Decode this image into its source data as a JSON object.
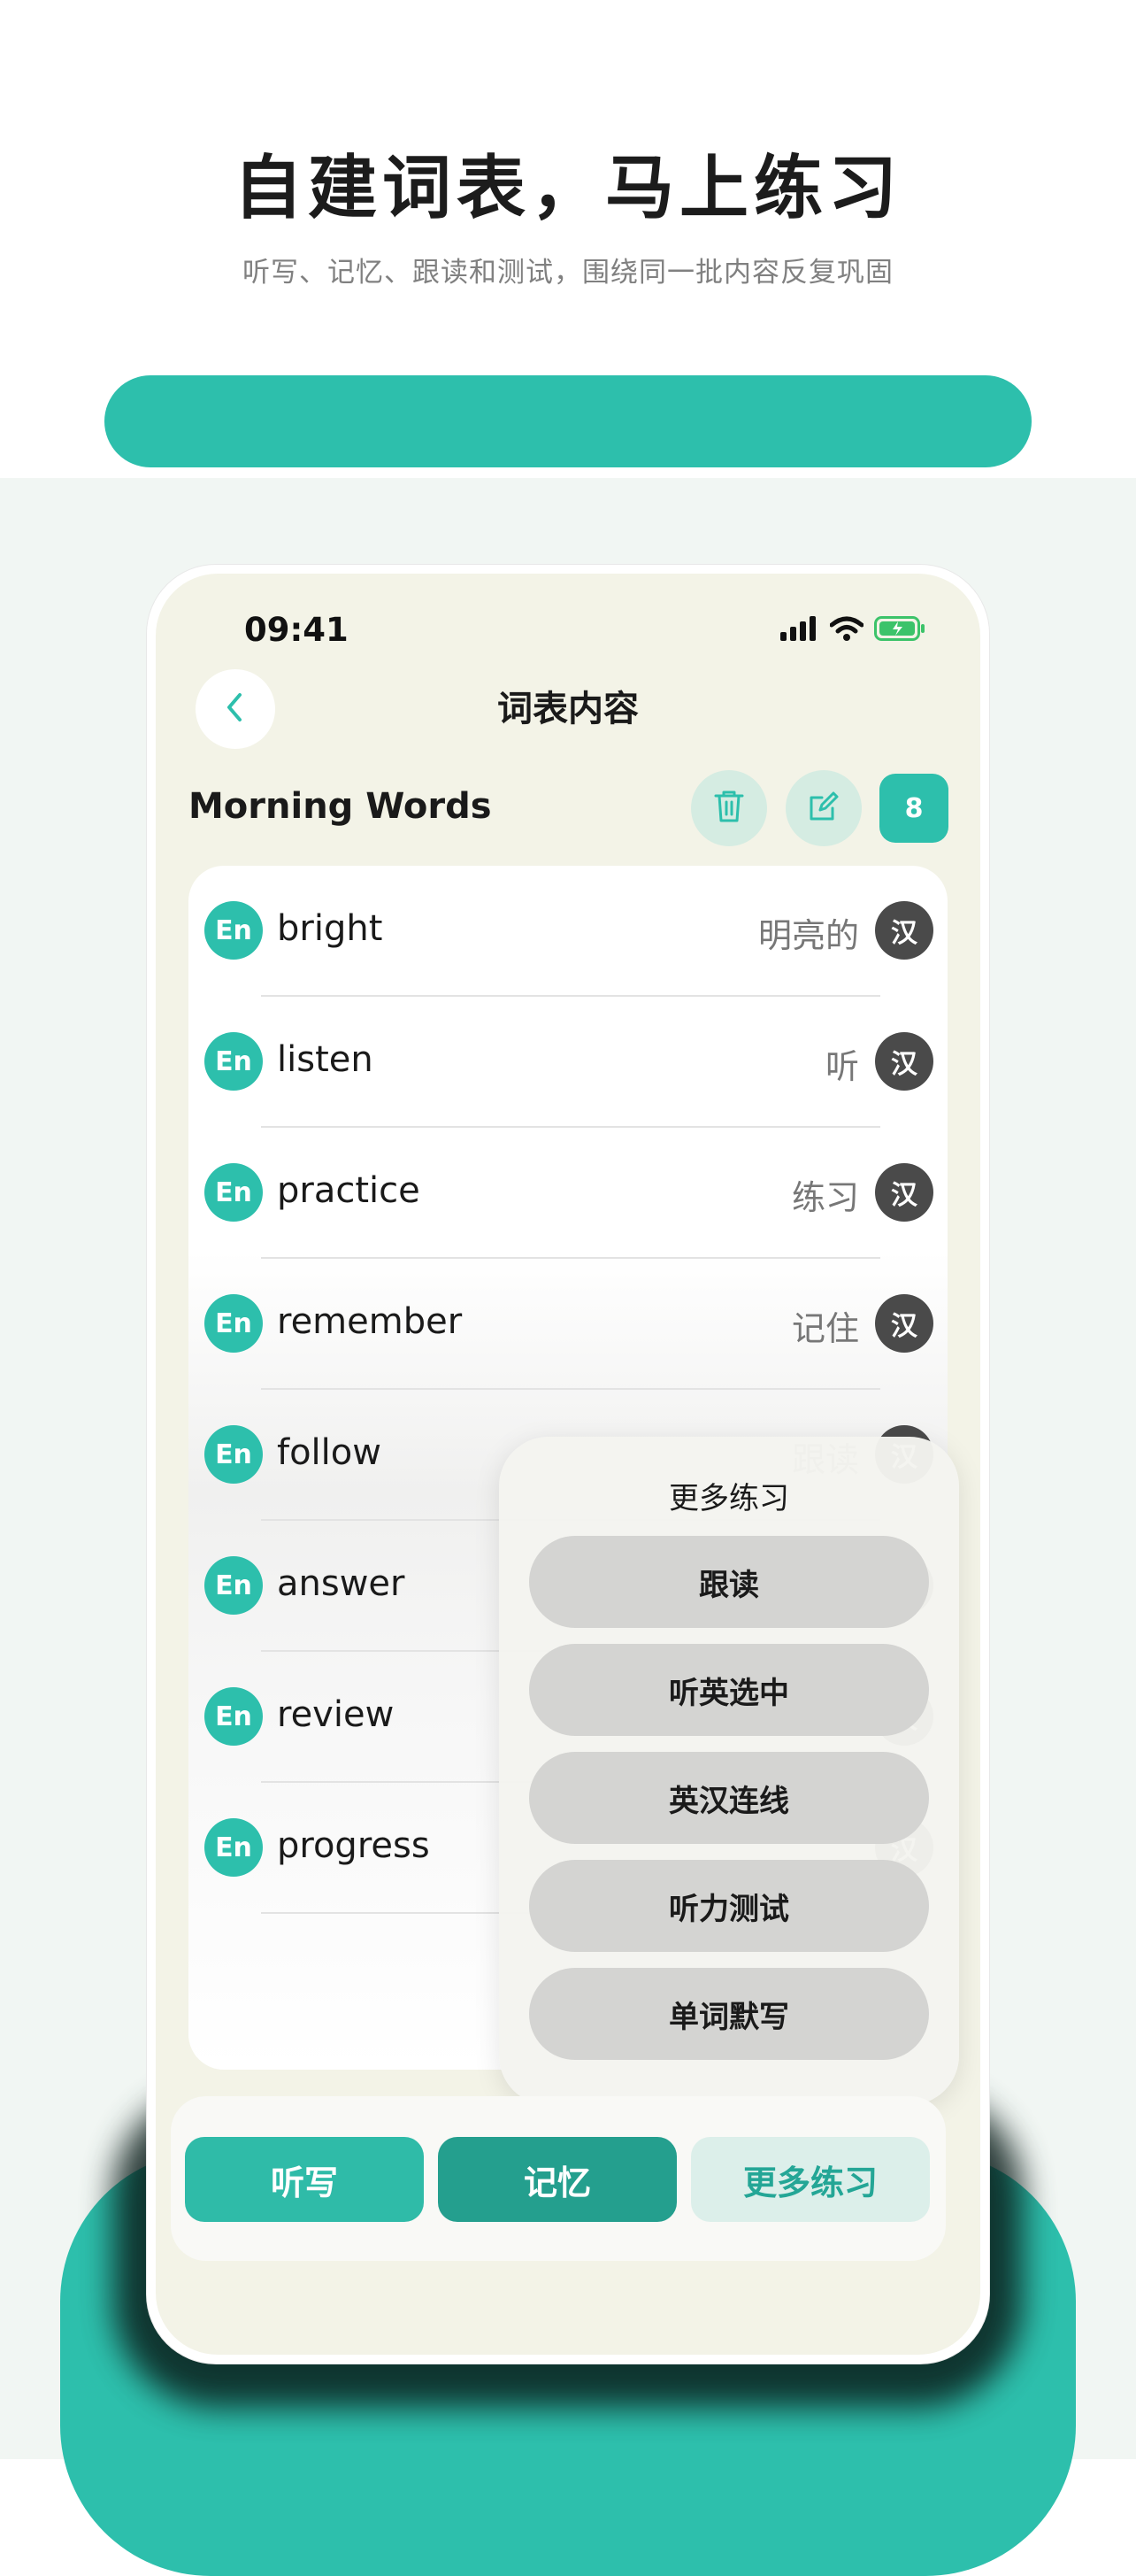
{
  "hero": {
    "title": "自建词表，马上练习",
    "subtitle": "听写、记忆、跟读和测试，围绕同一批内容反复巩固"
  },
  "status_bar": {
    "time": "09:41"
  },
  "nav": {
    "title": "词表内容"
  },
  "list": {
    "name": "Morning Words",
    "count": "8"
  },
  "words": [
    {
      "badge": "En",
      "word": "bright",
      "meaning": "明亮的",
      "zh": "汉"
    },
    {
      "badge": "En",
      "word": "listen",
      "meaning": "听",
      "zh": "汉"
    },
    {
      "badge": "En",
      "word": "practice",
      "meaning": "练习",
      "zh": "汉"
    },
    {
      "badge": "En",
      "word": "remember",
      "meaning": "记住",
      "zh": "汉"
    },
    {
      "badge": "En",
      "word": "follow",
      "meaning": "跟读",
      "zh": "汉"
    },
    {
      "badge": "En",
      "word": "answer",
      "meaning": "",
      "zh": "汉"
    },
    {
      "badge": "En",
      "word": "review",
      "meaning": "",
      "zh": "汉"
    },
    {
      "badge": "En",
      "word": "progress",
      "meaning": "",
      "zh": "汉"
    }
  ],
  "popup": {
    "title": "更多练习",
    "options": [
      "跟读",
      "听英选中",
      "英汉连线",
      "听力测试",
      "单词默写"
    ]
  },
  "bottom_tabs": {
    "listen": "听写",
    "memory": "记忆",
    "more": "更多练习"
  },
  "colors": {
    "accent": "#2dbfac",
    "accent_dark": "#249f8e",
    "badge_dark": "#4a4a4a",
    "screen_bg": "#f3f3e7"
  },
  "icons": [
    "back-chevron-icon",
    "trash-icon",
    "edit-icon",
    "signal-icon",
    "wifi-icon",
    "battery-icon"
  ]
}
